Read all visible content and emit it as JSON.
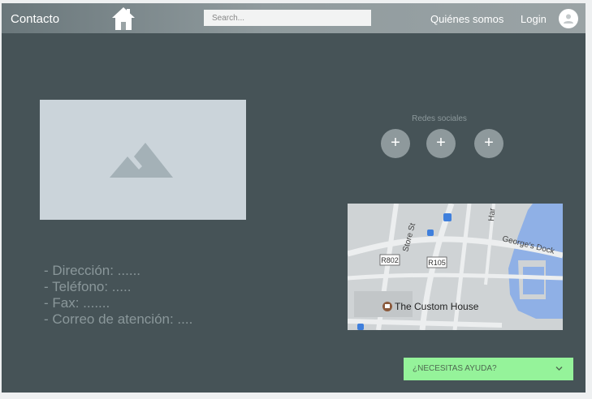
{
  "header": {
    "brand": "Contacto",
    "home_icon": "home-icon",
    "search_placeholder": "Search...",
    "nav": {
      "about": "Quiénes somos",
      "login": "Login"
    },
    "avatar_icon": "user-avatar-icon"
  },
  "image_placeholder_icon": "image-icon",
  "contact": {
    "lines": [
      "- Dirección: ......",
      "- Teléfono: .....",
      "- Fax: .......",
      "- Correo de atención: ...."
    ]
  },
  "social": {
    "title": "Redes sociales",
    "buttons": [
      "+",
      "+",
      "+"
    ]
  },
  "map": {
    "labels": {
      "store_st": "Store St",
      "georges_dock": "George's Dock",
      "custom_house": "The Custom House",
      "r802": "R802",
      "r105": "R105",
      "har": "Har"
    }
  },
  "help_button": {
    "label": "¿NECESITAS AYUDA?",
    "icon": "chevron-down-icon"
  },
  "colors": {
    "background": "#465357",
    "topbar": "#909b9e",
    "help": "#95f39a",
    "social_button": "#8e999c"
  }
}
